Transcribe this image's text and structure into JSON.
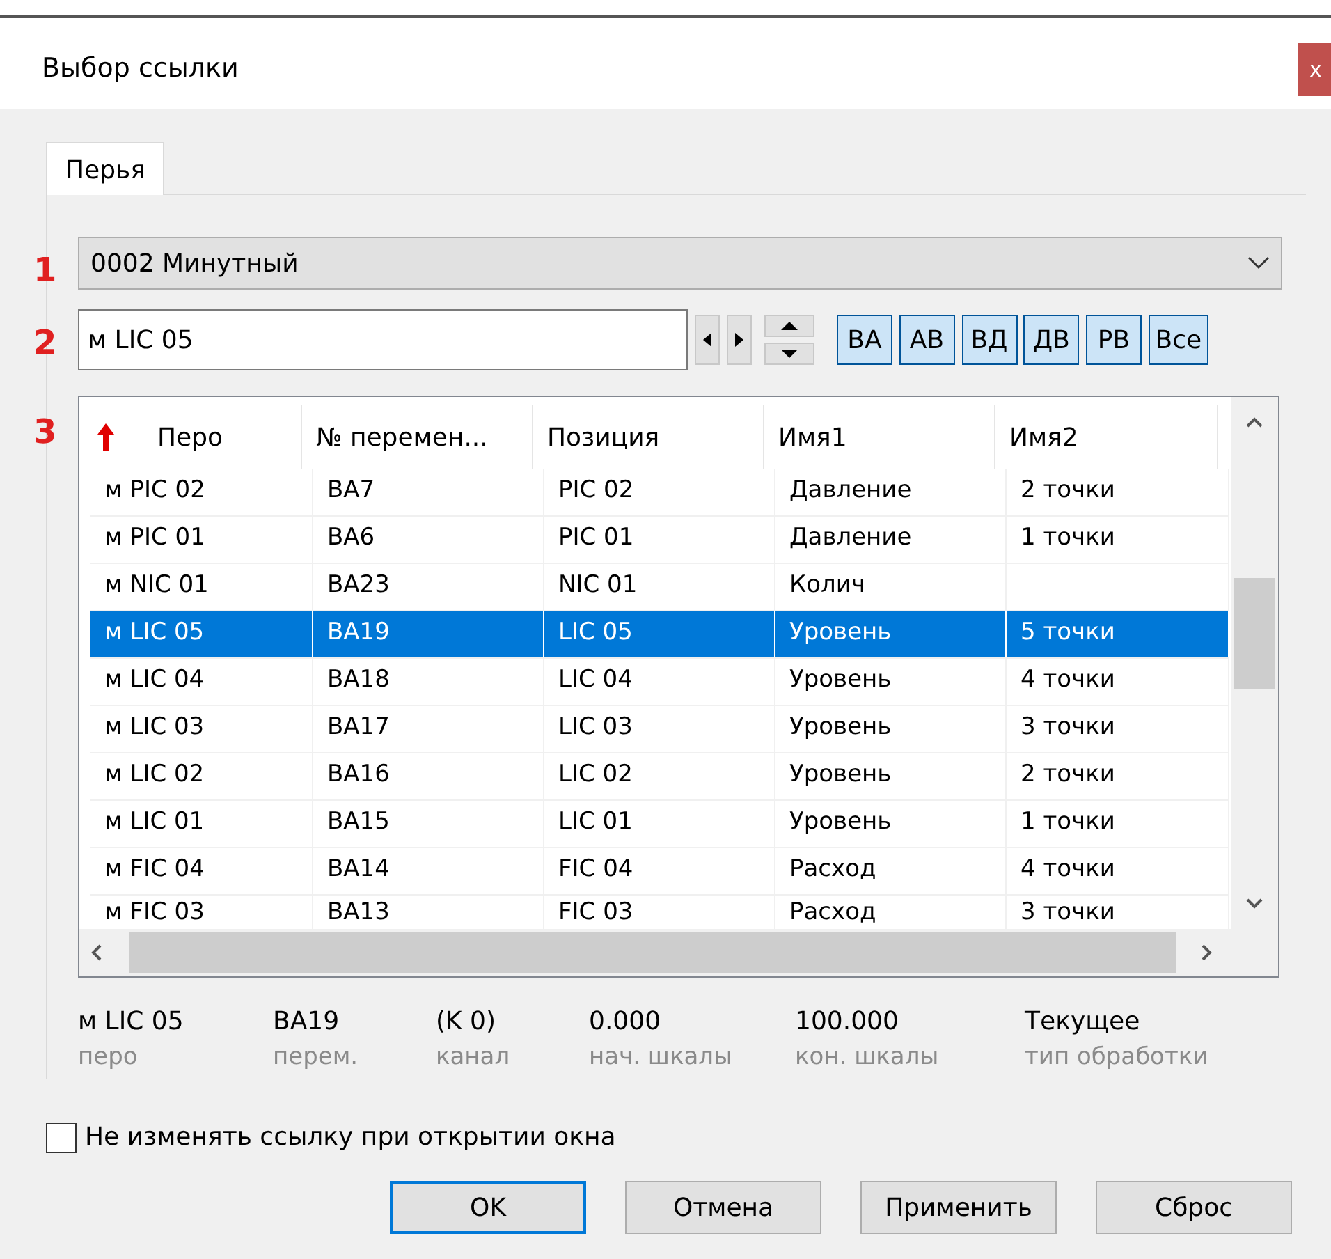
{
  "window": {
    "title": "Выбор ссылки",
    "close": "x"
  },
  "annotations": [
    "1",
    "2",
    "3"
  ],
  "tabs": [
    {
      "label": "Перья",
      "selected": true
    }
  ],
  "archive_select": {
    "value": "0002 Минутный"
  },
  "search": {
    "value": "м LIC 05"
  },
  "filter_buttons": [
    "ВА",
    "АВ",
    "ВД",
    "ДВ",
    "РВ",
    "Все"
  ],
  "table": {
    "columns": [
      {
        "label": "Перо",
        "sorted": true
      },
      {
        "label": "№ перемен...",
        "sorted": false
      },
      {
        "label": "Позиция",
        "sorted": false
      },
      {
        "label": "Имя1",
        "sorted": false
      },
      {
        "label": "Имя2",
        "sorted": false
      }
    ],
    "rows": [
      {
        "cells": [
          "м PIC 02",
          "BA7",
          "PIC 02",
          "Давление",
          "2 точки"
        ],
        "selected": false
      },
      {
        "cells": [
          "м PIC 01",
          "BA6",
          "PIC 01",
          "Давление",
          "1 точки"
        ],
        "selected": false
      },
      {
        "cells": [
          "м NIC 01",
          "BA23",
          "NIC 01",
          "Колич",
          ""
        ],
        "selected": false
      },
      {
        "cells": [
          "м LIC 05",
          "BA19",
          "LIC 05",
          "Уровень",
          "5 точки"
        ],
        "selected": true
      },
      {
        "cells": [
          "м LIC 04",
          "BA18",
          "LIC 04",
          "Уровень",
          "4 точки"
        ],
        "selected": false
      },
      {
        "cells": [
          "м LIC 03",
          "BA17",
          "LIC 03",
          "Уровень",
          "3 точки"
        ],
        "selected": false
      },
      {
        "cells": [
          "м LIC 02",
          "BA16",
          "LIC 02",
          "Уровень",
          "2 точки"
        ],
        "selected": false
      },
      {
        "cells": [
          "м LIC 01",
          "BA15",
          "LIC 01",
          "Уровень",
          "1 точки"
        ],
        "selected": false
      },
      {
        "cells": [
          "м FIC 04",
          "BA14",
          "FIC 04",
          "Расход",
          "4 точки"
        ],
        "selected": false
      },
      {
        "cells": [
          "м FIC 03",
          "BA13",
          "FIC 03",
          "Расход",
          "3 точки"
        ],
        "selected": false
      }
    ]
  },
  "details": [
    {
      "value": "м LIC 05",
      "label": "перо"
    },
    {
      "value": "BA19",
      "label": "перем."
    },
    {
      "value": "(K 0)",
      "label": "канал"
    },
    {
      "value": "0.000",
      "label": "нач. шкалы"
    },
    {
      "value": "100.000",
      "label": "кон. шкалы"
    },
    {
      "value": "Текущее",
      "label": "тип обработки"
    }
  ],
  "keep_link": {
    "label": "Не изменять ссылку при открытии окна",
    "checked": false
  },
  "buttons": [
    {
      "label": "OK",
      "default": true
    },
    {
      "label": "Отмена",
      "default": false
    },
    {
      "label": "Применить",
      "default": false
    },
    {
      "label": "Сброс",
      "default": false
    }
  ]
}
